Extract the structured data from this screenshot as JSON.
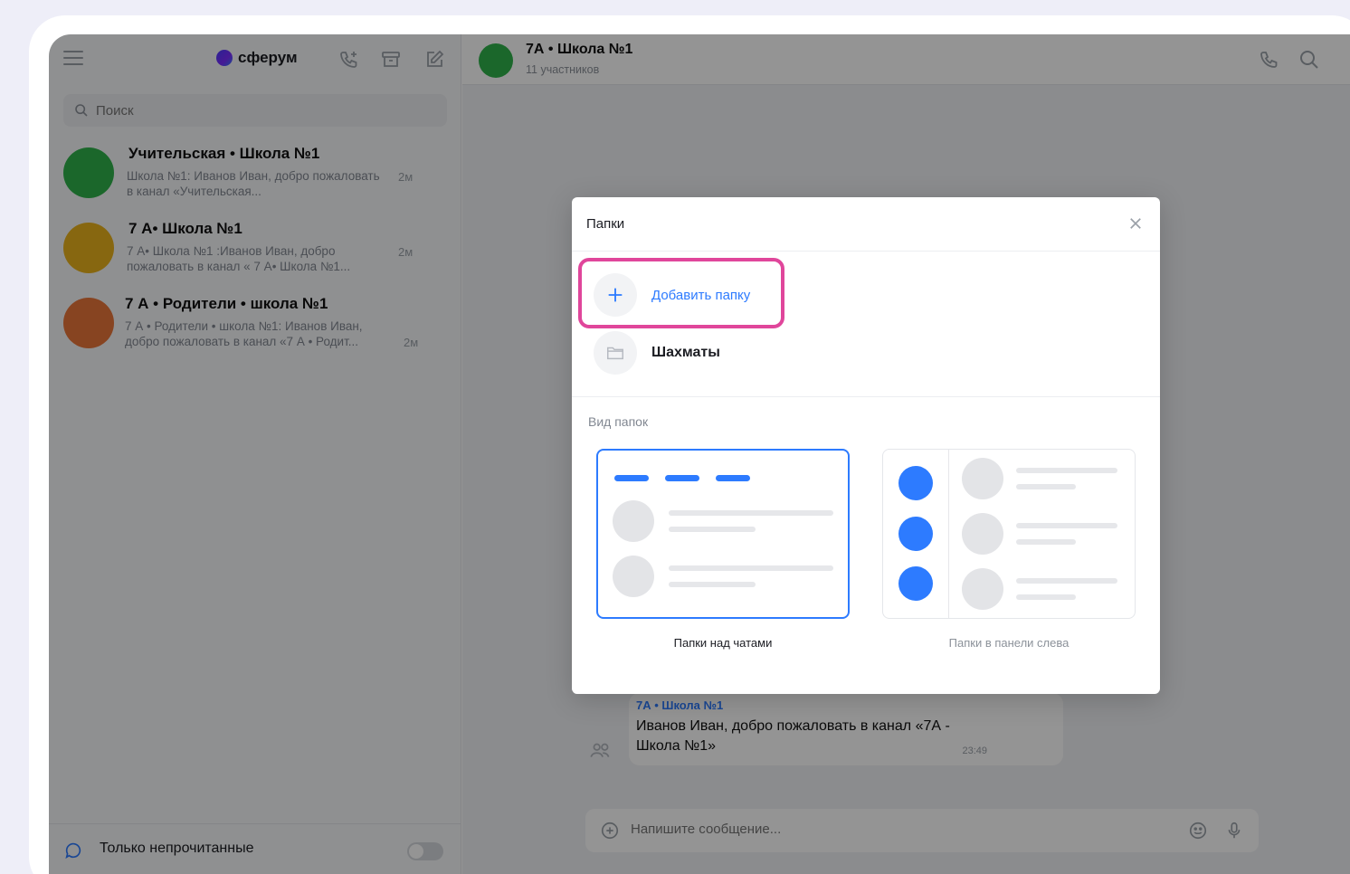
{
  "app": {
    "brand": "сферум"
  },
  "search": {
    "placeholder": "Поиск"
  },
  "chats": [
    {
      "name": "Учительская • Школа №1",
      "preview": "Школа №1: Иванов Иван, добро пожаловать в канал «Учительская...",
      "time": "2м",
      "avatar_color": "#2fb24a"
    },
    {
      "name": "7 А• Школа №1",
      "preview": "7 А• Школа №1 :Иванов Иван, добро пожаловать в канал « 7 А• Школа №1...",
      "time": "2м",
      "avatar_color": "#e9b21c"
    },
    {
      "name": "7 А • Родители • школа №1",
      "preview": "7 А • Родители • школа №1: Иванов Иван, добро пожаловать в канал «7 А • Родит...",
      "time": "2м",
      "avatar_color": "#e8753a"
    }
  ],
  "sidebar_footer": {
    "label": "Только непрочитанные"
  },
  "conversation": {
    "title": "7А • Школа №1",
    "subtitle": "11 участников",
    "message": {
      "from": "7А • Школа №1",
      "text": "Иванов Иван, добро пожаловать в канал «7А - Школа №1»",
      "time": "23:49"
    },
    "composer_placeholder": "Напишите сообщение..."
  },
  "modal": {
    "title": "Папки",
    "add_label": "Добавить папку",
    "folders": [
      "Шахматы"
    ],
    "view_title": "Вид папок",
    "options": [
      {
        "label": "Папки над чатами",
        "selected": true
      },
      {
        "label": "Папки в панели слева",
        "selected": false
      }
    ]
  },
  "colors": {
    "accent": "#2d7bff",
    "highlight": "#e0469b"
  }
}
